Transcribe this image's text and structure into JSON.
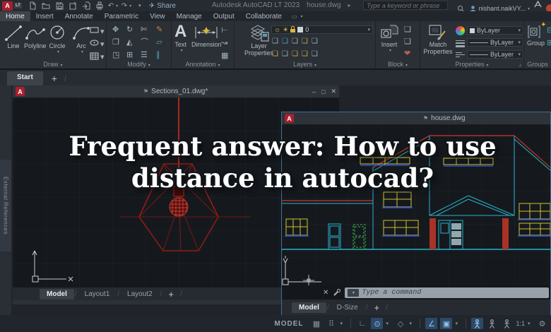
{
  "titlebar": {
    "logo_letter": "A",
    "logo_lt": "LT",
    "undo_glyph": "↶",
    "redo_glyph": "↷",
    "share_glyph": "✈",
    "share_label": "Share",
    "app_title": "Autodesk AutoCAD LT 2023",
    "doc_title": "house.dwg",
    "expand_glyph": "▸",
    "search_placeholder": "Type a keyword or phrase",
    "user_name": "nishant.naikVY..."
  },
  "ribbon_tabs": {
    "items": [
      "Home",
      "Insert",
      "Annotate",
      "Parametric",
      "View",
      "Manage",
      "Output",
      "Collaborate"
    ],
    "active": "Home",
    "minimize_glyph": "▭"
  },
  "ribbon": {
    "draw": {
      "label": "Draw",
      "tools": [
        "Line",
        "Polyline",
        "Circle",
        "Arc"
      ]
    },
    "modify": {
      "label": "Modify",
      "icons": [
        "✥",
        "↻",
        "✄",
        "✎",
        "❐",
        "◭",
        "⌒",
        "▱",
        "◳",
        "⊞",
        "☰",
        "∥"
      ]
    },
    "annotation": {
      "label": "Annotation",
      "text_icon": "A",
      "text_label": "Text",
      "dimension_label": "Dimension",
      "side_icons": [
        "⊢",
        "↝",
        "▦"
      ]
    },
    "layers": {
      "label": "Layers",
      "big_label_1": "Layer",
      "big_label_2": "Properties",
      "bulb_glyph": "☼",
      "sun_glyph": "☀",
      "current_layer": "0",
      "row_icons": [
        "❏",
        "❏",
        "❏",
        "❏",
        "❏",
        "❏",
        "❏",
        "❏",
        "❏",
        "❏"
      ]
    },
    "block": {
      "label": "Block",
      "insert_label": "Insert",
      "side_icons": [
        "❑",
        "❑",
        "❤"
      ]
    },
    "properties": {
      "label": "Properties",
      "match_label_1": "Match",
      "match_label_2": "Properties",
      "color_value": "ByLayer",
      "lineweight_value": "ByLayer",
      "linetype_value": "ByLayer"
    },
    "groups": {
      "label": "Groups",
      "group_label": "Group",
      "star_glyph": "✦"
    }
  },
  "file_tabs": {
    "start_label": "Start",
    "add_label": "+"
  },
  "palette": {
    "label": "External References"
  },
  "windows": {
    "sections": {
      "title": "Sections_01.dwg*",
      "pin_glyph": "⚑",
      "min_glyph": "–",
      "max_glyph": "□",
      "close_glyph": "✕",
      "tabs": [
        "Model",
        "Layout1",
        "Layout2"
      ],
      "add_tab": "+"
    },
    "house": {
      "title": "house.dwg",
      "pin_glyph": "⚑",
      "close_glyph": "✕",
      "command_placeholder": "Type a command",
      "tabs": [
        "Model",
        "D-Size"
      ],
      "add_tab": "+"
    }
  },
  "overlay": {
    "line1": "Frequent answer: How to use",
    "line2": "distance in autocad?"
  },
  "statusbar": {
    "model_label": "MODEL",
    "grid_glyph": "▦",
    "snap_glyph": "⠿",
    "ortho_glyph": "∟",
    "polar_glyph": "⊙",
    "iso_glyph": "◇",
    "otrack_glyph": "∠",
    "osnap_glyph": "▣",
    "scale_label": "1:1",
    "gear_glyph": "⚙"
  },
  "colors": {
    "accent_blue": "#4a90d2",
    "cad_red": "#b03228",
    "cad_cyan": "#27b3c9",
    "cad_yellow": "#cfc12e",
    "cad_green": "#3fae49",
    "canvas": "#14181d"
  }
}
